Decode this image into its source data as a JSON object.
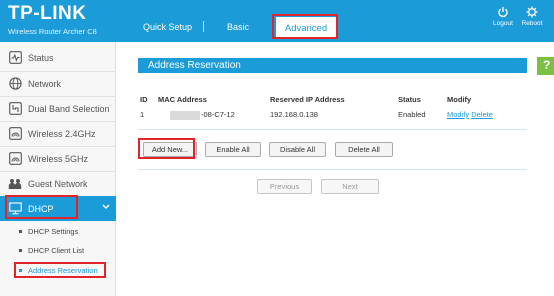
{
  "header": {
    "logo": "TP-LINK",
    "model": "Wireless Router Archer C8",
    "tabs": [
      {
        "label": "Quick Setup"
      },
      {
        "label": "Basic"
      },
      {
        "label": "Advanced"
      }
    ],
    "tools": [
      {
        "label": "Logout",
        "icon": "power-icon"
      },
      {
        "label": "Reboot",
        "icon": "reboot-icon"
      }
    ]
  },
  "sidebar": {
    "items": [
      {
        "label": "Status",
        "icon": "status-icon"
      },
      {
        "label": "Network",
        "icon": "globe-icon"
      },
      {
        "label": "Dual Band Selection",
        "icon": "dual-band-icon"
      },
      {
        "label": "Wireless 2.4GHz",
        "icon": "wifi-icon"
      },
      {
        "label": "Wireless 5GHz",
        "icon": "wifi-icon"
      },
      {
        "label": "Guest Network",
        "icon": "guest-icon"
      },
      {
        "label": "DHCP",
        "icon": "monitor-icon"
      }
    ],
    "subitems": [
      {
        "label": "DHCP Settings"
      },
      {
        "label": "DHCP Client List"
      },
      {
        "label": "Address Reservation"
      }
    ]
  },
  "main": {
    "title": "Address Reservation",
    "help": "?",
    "columns": [
      "ID",
      "MAC Address",
      "Reserved IP Address",
      "Status",
      "Modify"
    ],
    "rows": [
      {
        "id": "1",
        "mac_visible": "-08-C7-12",
        "ip": "192.168.0.138",
        "status": "Enabled",
        "modify": "Modify",
        "delete": "Delete"
      }
    ],
    "buttons": {
      "add_new": "Add New...",
      "enable_all": "Enable All",
      "disable_all": "Disable All",
      "delete_all": "Delete All",
      "previous": "Previous",
      "next": "Next"
    }
  },
  "colors": {
    "brand": "#1b9bd7",
    "help": "#7ac143",
    "highlight": "#e3232a"
  }
}
